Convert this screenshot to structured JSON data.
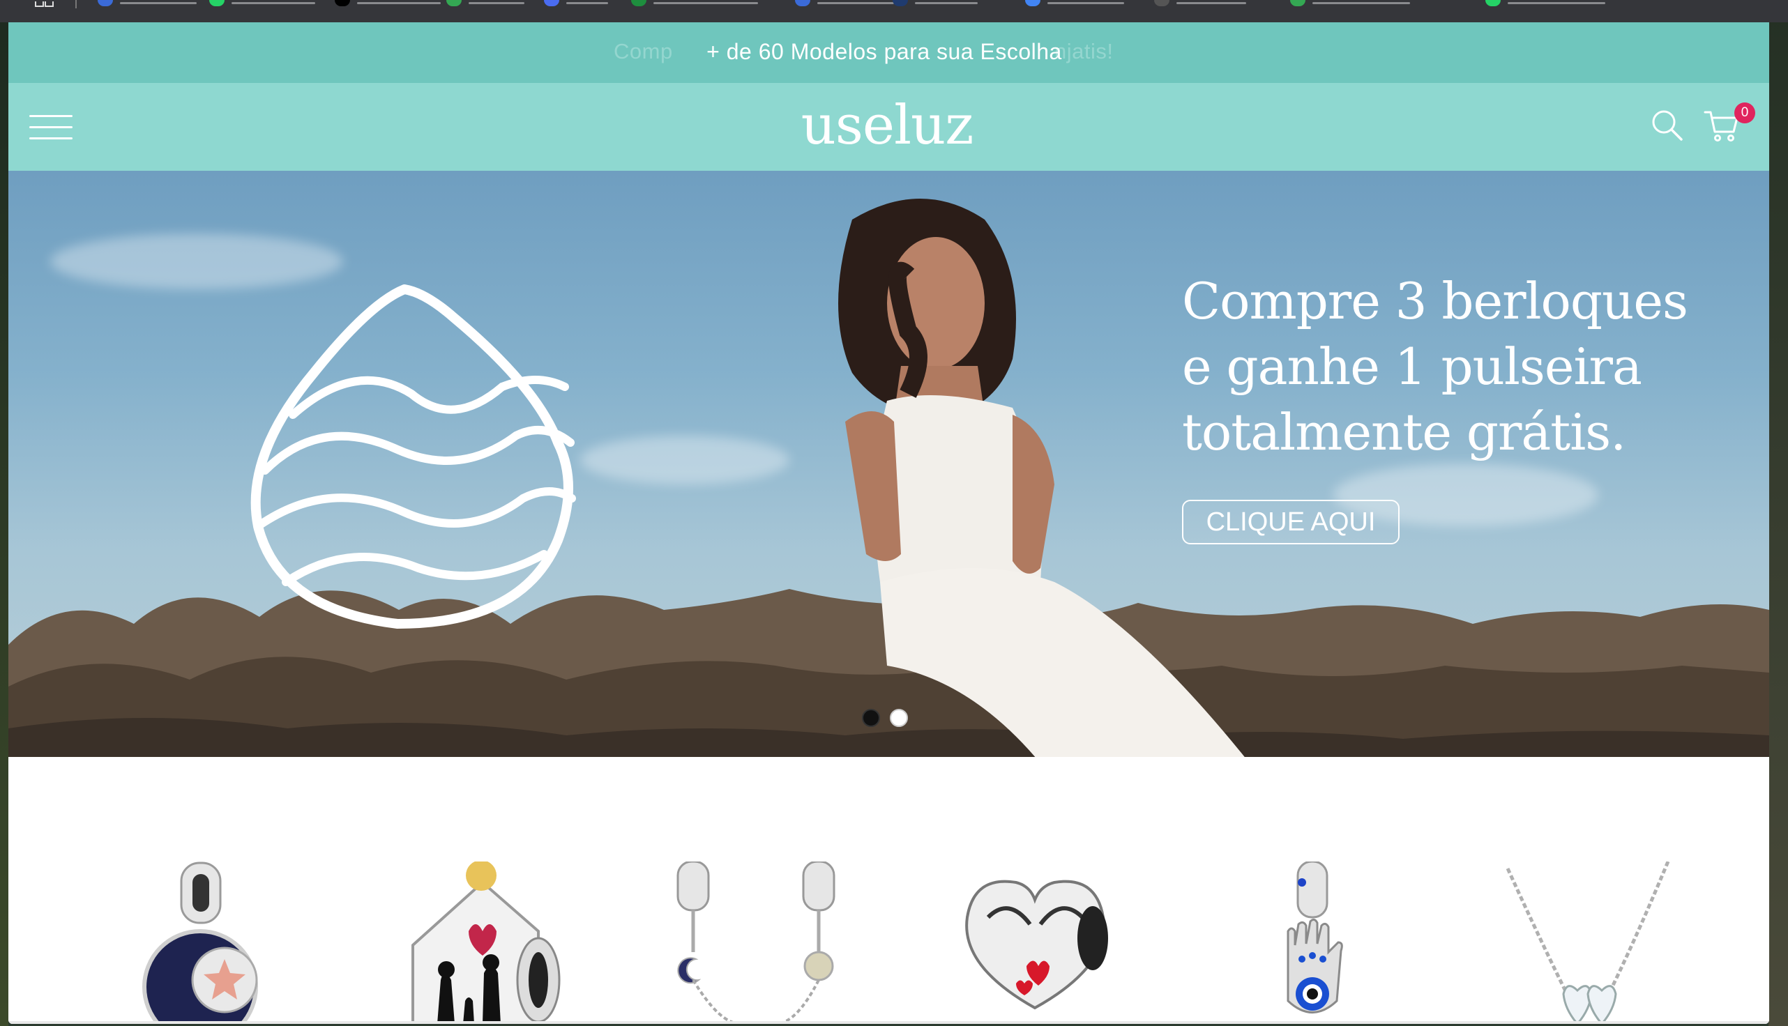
{
  "bookmarks_bar": {
    "items": [
      {
        "icon": "bookmark-favicon-blue",
        "color": "#3b6bd8"
      },
      {
        "icon": "whatsapp-icon",
        "color": "#25d366"
      },
      {
        "icon": "bookmark-favicon-black",
        "color": "#000000"
      },
      {
        "icon": "bookmark-favicon-green",
        "color": "#34a853"
      },
      {
        "icon": "bookmark-favicon-blue",
        "color": "#4a6cf0"
      },
      {
        "icon": "bookmark-favicon-green-square",
        "color": "#1e8e3e"
      },
      {
        "icon": "bookmark-favicon-blue",
        "color": "#3b6bd8"
      },
      {
        "icon": "bookmark-favicon-navy",
        "color": "#1f3b6f"
      },
      {
        "icon": "bookmark-favicon-blue-circle",
        "color": "#4285f4"
      },
      {
        "icon": "bookmark-favicon-gray",
        "color": "#555555"
      },
      {
        "icon": "bookmark-favicon-green-square",
        "color": "#34a853"
      },
      {
        "icon": "whatsapp-icon",
        "color": "#25d366"
      }
    ]
  },
  "announcement": {
    "text": "+ de 60 Modelos para sua Escolha",
    "ghost_left": "Comp",
    "ghost_right": "njatis!",
    "background": "#6fc6bd"
  },
  "header": {
    "logo": "useluz",
    "background": "#8ed8d0",
    "cart_count": "0",
    "menu_icon": "hamburger-menu-icon",
    "search_icon": "search-icon",
    "cart_icon": "cart-icon"
  },
  "hero": {
    "title_lines": [
      "Compre 3 berloques",
      "e ganhe 1 pulseira",
      "totalmente grátis."
    ],
    "cta": "CLIQUE AQUI",
    "slides_total": 2,
    "active_slide": 1
  },
  "products": [
    {
      "name": "celestial-dangle-charm",
      "icon": "charm-icon"
    },
    {
      "name": "family-house-charm",
      "icon": "charm-icon"
    },
    {
      "name": "moon-sun-safety-chain-charm",
      "icon": "charm-icon"
    },
    {
      "name": "kissing-couple-heart-charm",
      "icon": "charm-icon"
    },
    {
      "name": "hamsa-evil-eye-dangle-charm",
      "icon": "charm-icon"
    },
    {
      "name": "heart-necklace",
      "icon": "necklace-icon"
    }
  ]
}
